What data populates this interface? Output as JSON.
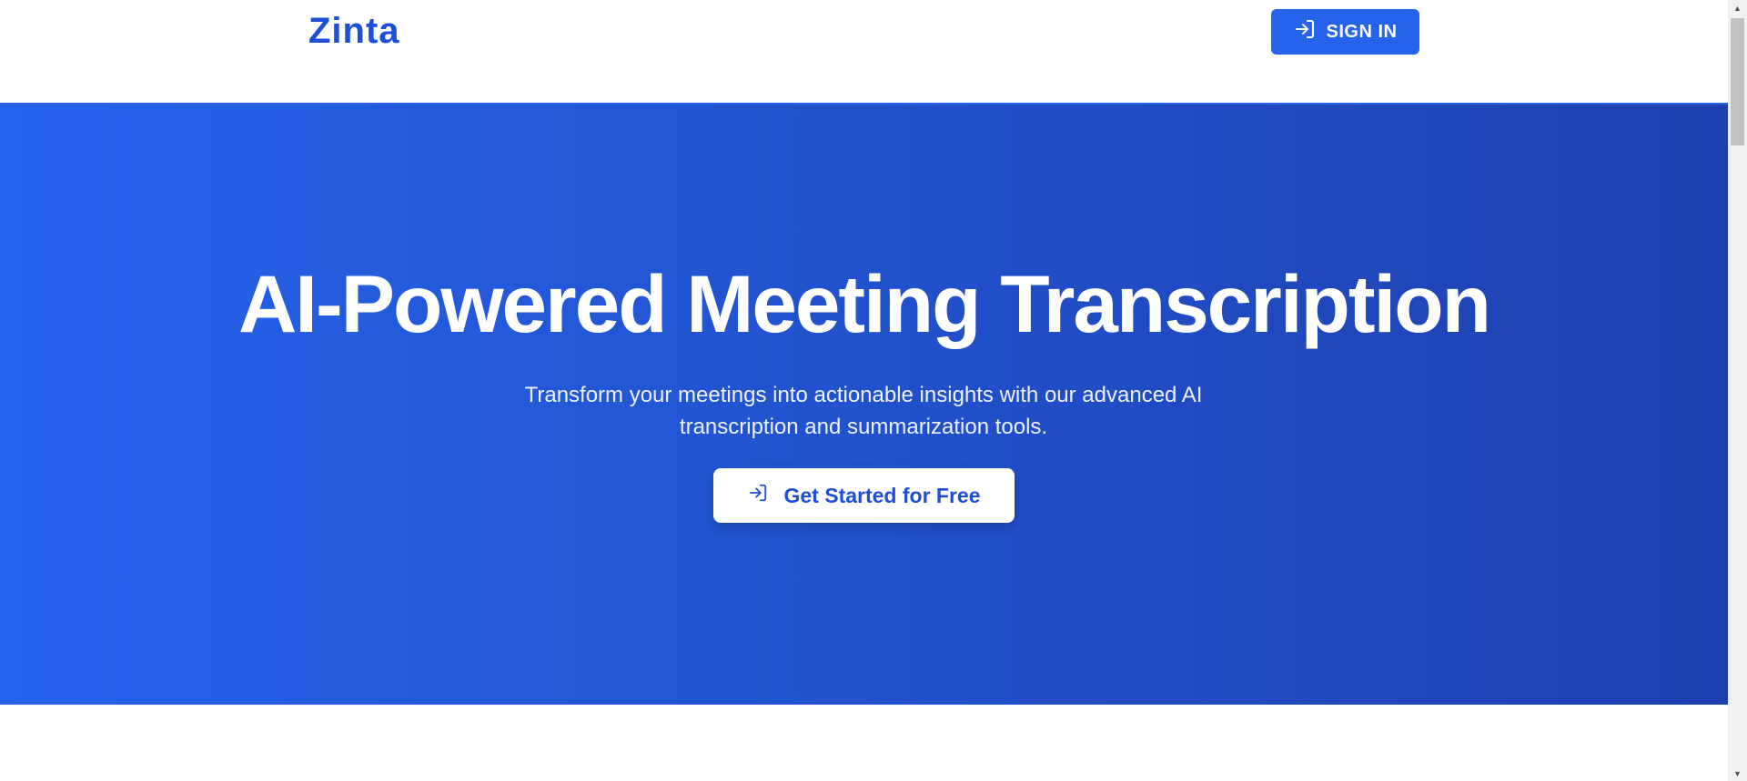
{
  "header": {
    "logo": "Zinta",
    "signin_label": "SIGN IN",
    "signin_icon": "sign-in-icon"
  },
  "hero": {
    "title": "AI-Powered Meeting Transcription",
    "subtitle": "Transform your meetings into actionable insights with our advanced AI transcription and summarization tools.",
    "cta_label": "Get Started for Free",
    "cta_icon": "sign-in-icon"
  },
  "colors": {
    "accent": "#2563eb",
    "accent_dark": "#1e40af",
    "logo": "#1d4ed8",
    "background": "#ffffff"
  },
  "scrollbar": {
    "up_icon": "scroll-up-arrow-icon",
    "down_icon": "scroll-down-arrow-icon"
  }
}
